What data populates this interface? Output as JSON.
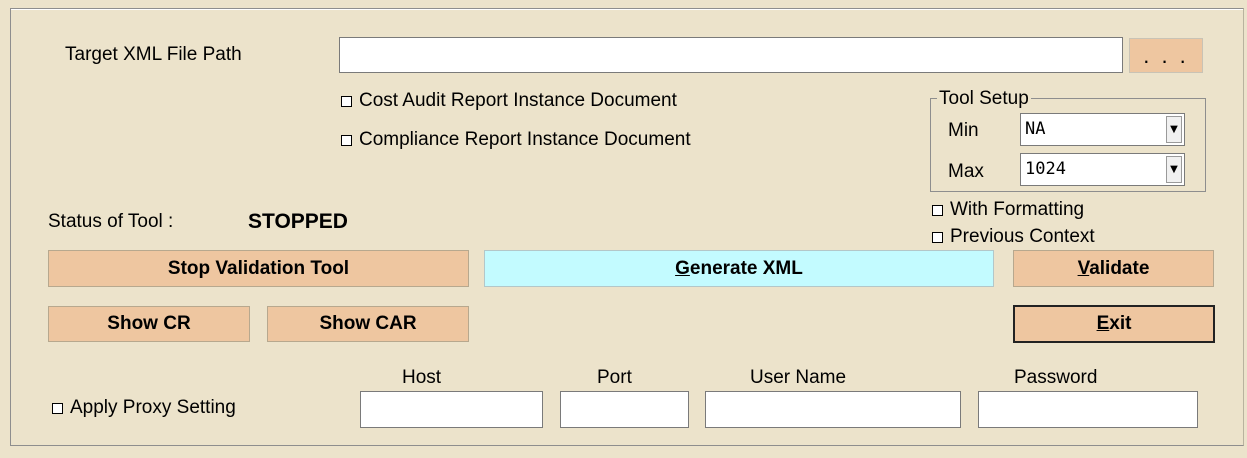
{
  "target": {
    "label": "Target XML File Path",
    "value": "",
    "browse_label": ". . ."
  },
  "documents": {
    "cost_audit": {
      "label": "Cost Audit Report Instance Document",
      "checked": false
    },
    "compliance": {
      "label": "Compliance Report Instance Document",
      "checked": false
    }
  },
  "tool_setup": {
    "title": "Tool Setup",
    "min_label": "Min",
    "min_value": "NA",
    "max_label": "Max",
    "max_value": "1024"
  },
  "options": {
    "with_formatting": {
      "label": "With Formatting",
      "checked": false
    },
    "previous_context": {
      "label": "Previous Context",
      "checked": false
    }
  },
  "status": {
    "label": "Status of Tool :",
    "value": "STOPPED"
  },
  "buttons": {
    "stop_validation": "Stop Validation Tool",
    "generate_xml_mnemonic": "G",
    "generate_xml_rest": "enerate XML",
    "validate_mnemonic": "V",
    "validate_rest": "alidate",
    "show_cr": "Show CR",
    "show_car": "Show CAR",
    "exit_mnemonic": "E",
    "exit_rest": "xit"
  },
  "proxy": {
    "apply_label": "Apply Proxy Setting",
    "apply_checked": false,
    "host_label": "Host",
    "host_value": "",
    "port_label": "Port",
    "port_value": "",
    "username_label": "User Name",
    "username_value": "",
    "password_label": "Password",
    "password_value": ""
  },
  "colors": {
    "background": "#ece3cb",
    "button": "#eec6a0",
    "generate_button": "#c3fbff"
  }
}
